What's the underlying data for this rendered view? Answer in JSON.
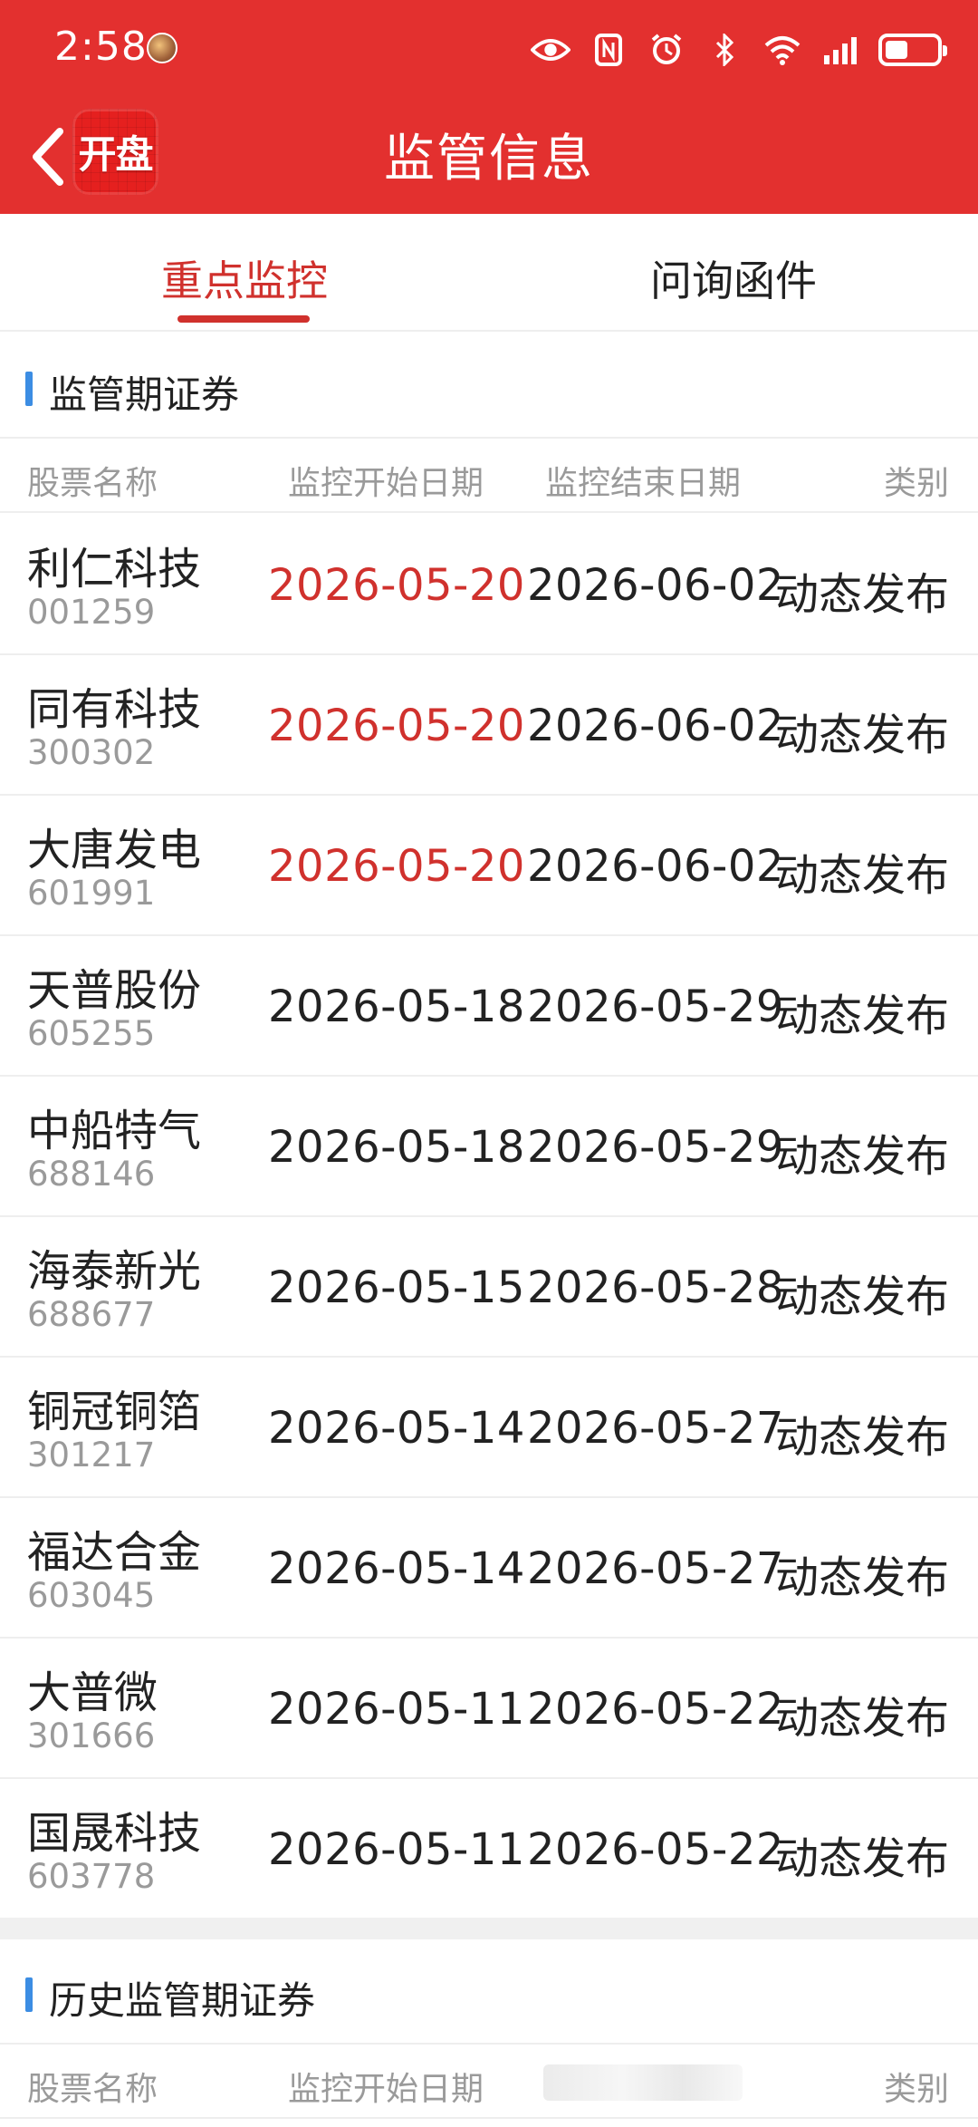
{
  "status_bar": {
    "time": "2:58",
    "icons": [
      "eye-icon",
      "nfc-icon",
      "alarm-icon",
      "bluetooth-icon",
      "wifi-icon",
      "signal-icon",
      "battery-icon"
    ]
  },
  "header": {
    "title": "监管信息",
    "logo_text": "开盘",
    "accent_color": "#e3302f"
  },
  "tabs": [
    {
      "label": "重点监控",
      "active": true
    },
    {
      "label": "问询函件",
      "active": false
    }
  ],
  "section_current": {
    "title": "监管期证券",
    "columns": {
      "name": "股票名称",
      "start": "监控开始日期",
      "end": "监控结束日期",
      "type": "类别"
    },
    "rows": [
      {
        "name": "利仁科技",
        "code": "001259",
        "start": "2026-05-20",
        "end": "2026-06-02",
        "type": "动态发布"
      },
      {
        "name": "同有科技",
        "code": "300302",
        "start": "2026-05-20",
        "end": "2026-06-02",
        "type": "动态发布"
      },
      {
        "name": "大唐发电",
        "code": "601991",
        "start": "2026-05-20",
        "end": "2026-06-02",
        "type": "动态发布"
      },
      {
        "name": "天普股份",
        "code": "605255",
        "start": "2026-05-18",
        "end": "2026-05-29",
        "type": "动态发布"
      },
      {
        "name": "中船特气",
        "code": "688146",
        "start": "2026-05-18",
        "end": "2026-05-29",
        "type": "动态发布"
      },
      {
        "name": "海泰新光",
        "code": "688677",
        "start": "2026-05-15",
        "end": "2026-05-28",
        "type": "动态发布"
      },
      {
        "name": "铜冠铜箔",
        "code": "301217",
        "start": "2026-05-14",
        "end": "2026-05-27",
        "type": "动态发布"
      },
      {
        "name": "福达合金",
        "code": "603045",
        "start": "2026-05-14",
        "end": "2026-05-27",
        "type": "动态发布"
      },
      {
        "name": "大普微",
        "code": "301666",
        "start": "2026-05-11",
        "end": "2026-05-22",
        "type": "动态发布"
      },
      {
        "name": "国晟科技",
        "code": "603778",
        "start": "2026-05-11",
        "end": "2026-05-22",
        "type": "动态发布"
      }
    ],
    "highlight_color": "#d0312d"
  },
  "section_history": {
    "title": "历史监管期证券",
    "columns": {
      "name": "股票名称",
      "start": "监控开始日期",
      "type": "类别"
    }
  }
}
